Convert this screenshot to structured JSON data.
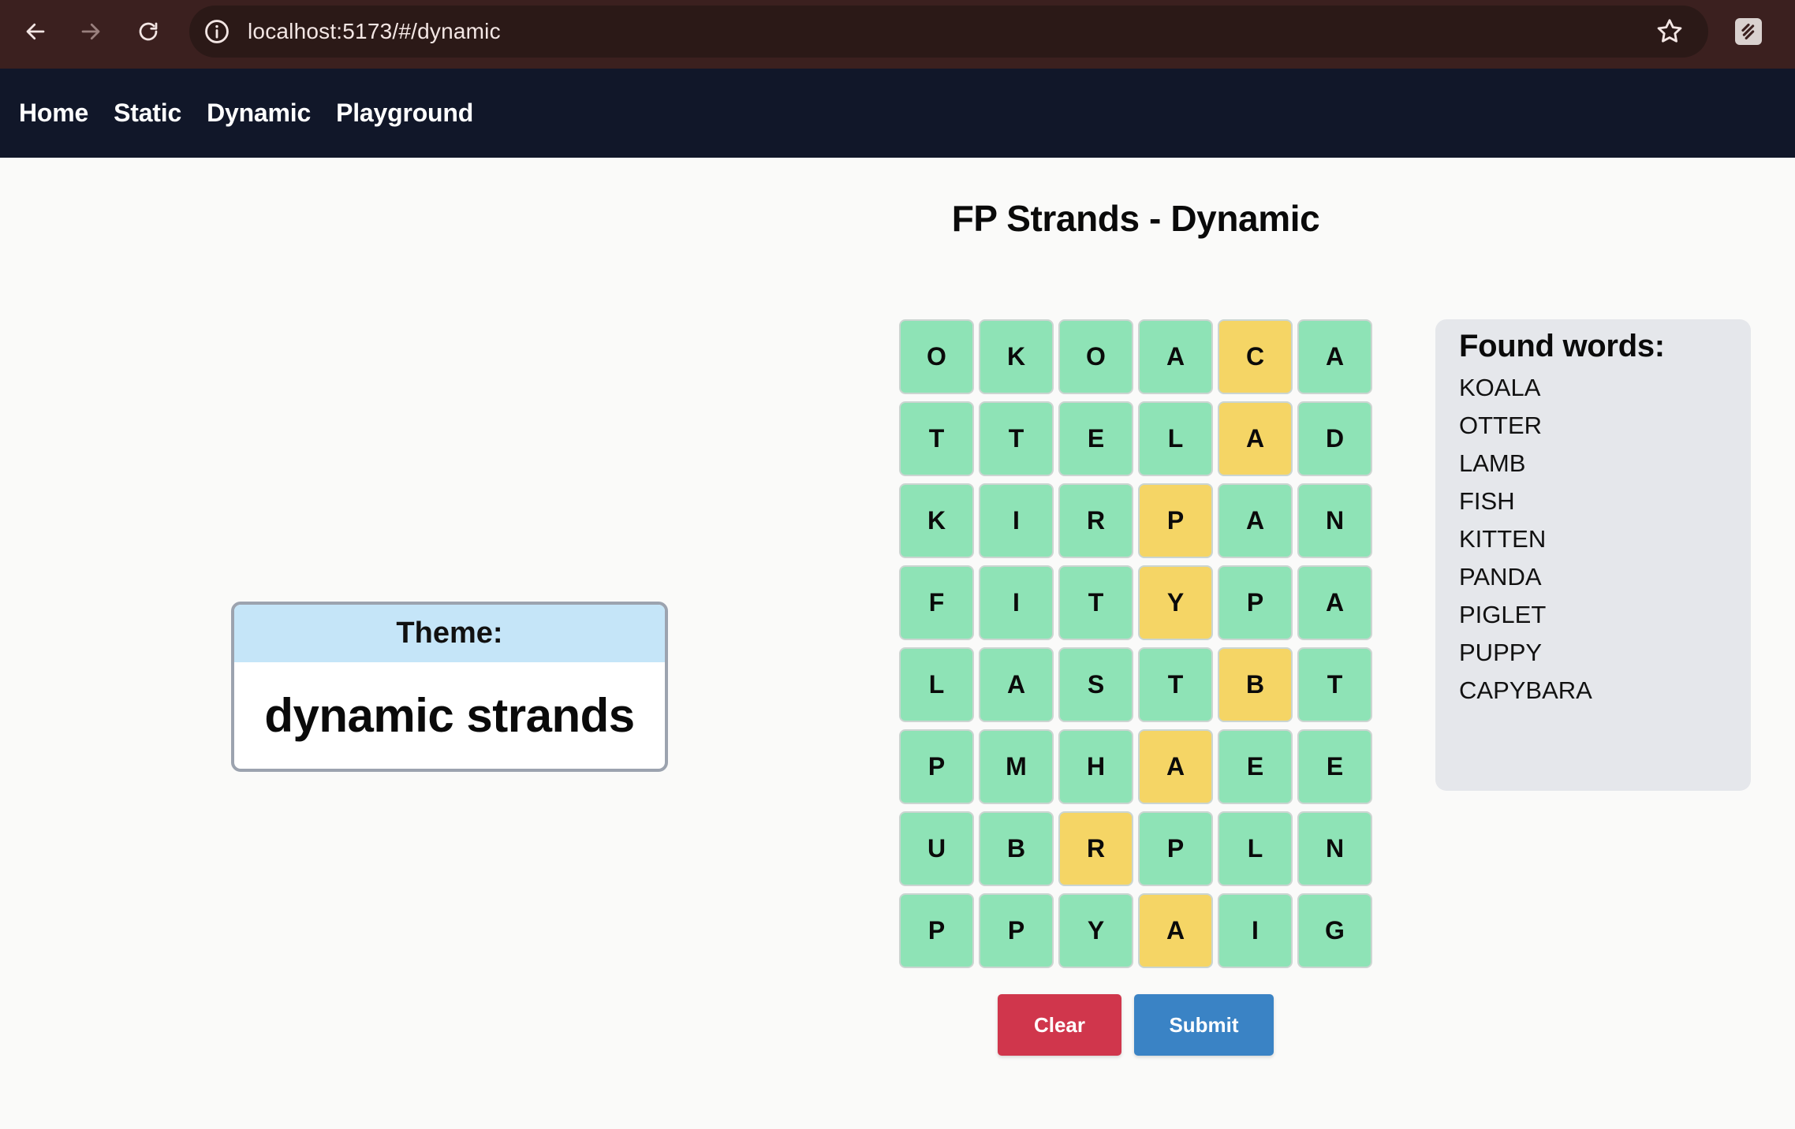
{
  "browser": {
    "url": "localhost:5173/#/dynamic"
  },
  "nav": {
    "links": [
      "Home",
      "Static",
      "Dynamic",
      "Playground"
    ]
  },
  "page": {
    "title": "FP Strands - Dynamic"
  },
  "theme": {
    "label": "Theme:",
    "value": "dynamic strands"
  },
  "grid": {
    "rows": [
      [
        "O",
        "K",
        "O",
        "A",
        "C",
        "A"
      ],
      [
        "T",
        "T",
        "E",
        "L",
        "A",
        "D"
      ],
      [
        "K",
        "I",
        "R",
        "P",
        "A",
        "N"
      ],
      [
        "F",
        "I",
        "T",
        "Y",
        "P",
        "A"
      ],
      [
        "L",
        "A",
        "S",
        "T",
        "B",
        "T"
      ],
      [
        "P",
        "M",
        "H",
        "A",
        "E",
        "E"
      ],
      [
        "U",
        "B",
        "R",
        "P",
        "L",
        "N"
      ],
      [
        "P",
        "P",
        "Y",
        "A",
        "I",
        "G"
      ]
    ],
    "selected": [
      [
        0,
        4
      ],
      [
        1,
        4
      ],
      [
        2,
        3
      ],
      [
        3,
        3
      ],
      [
        4,
        4
      ],
      [
        5,
        3
      ],
      [
        6,
        2
      ],
      [
        7,
        3
      ]
    ],
    "colors": {
      "found": "#8ee3b6",
      "selected": "#f5d565"
    }
  },
  "buttons": {
    "clear": "Clear",
    "submit": "Submit"
  },
  "found": {
    "title": "Found words:",
    "words": [
      "KOALA",
      "OTTER",
      "LAMB",
      "FISH",
      "KITTEN",
      "PANDA",
      "PIGLET",
      "PUPPY",
      "CAPYBARA"
    ]
  }
}
